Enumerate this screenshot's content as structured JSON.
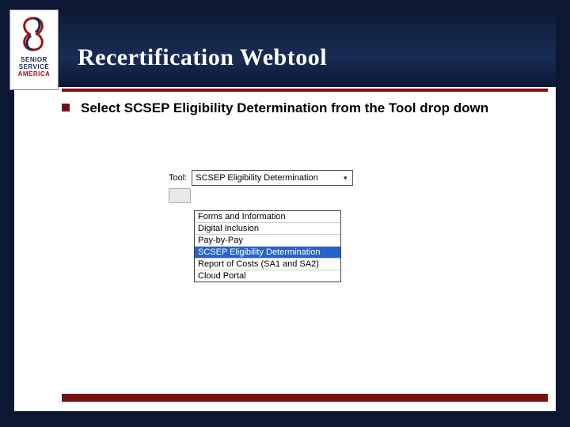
{
  "header": {
    "title": "Recertification Webtool"
  },
  "logo": {
    "line1": "SENIOR",
    "line2": "SERVICE",
    "line3": "AMERICA"
  },
  "body": {
    "bullet_text": "Select SCSEP Eligibility Determination from the Tool drop down"
  },
  "dropdown": {
    "label": "Tool:",
    "selected": "SCSEP Eligibility Determination",
    "options": [
      "Forms and Information",
      "Digital Inclusion",
      "Pay-by-Pay",
      "SCSEP Eligibility Determination",
      "Report of Costs (SA1 and SA2)",
      "Cloud Portal"
    ]
  }
}
